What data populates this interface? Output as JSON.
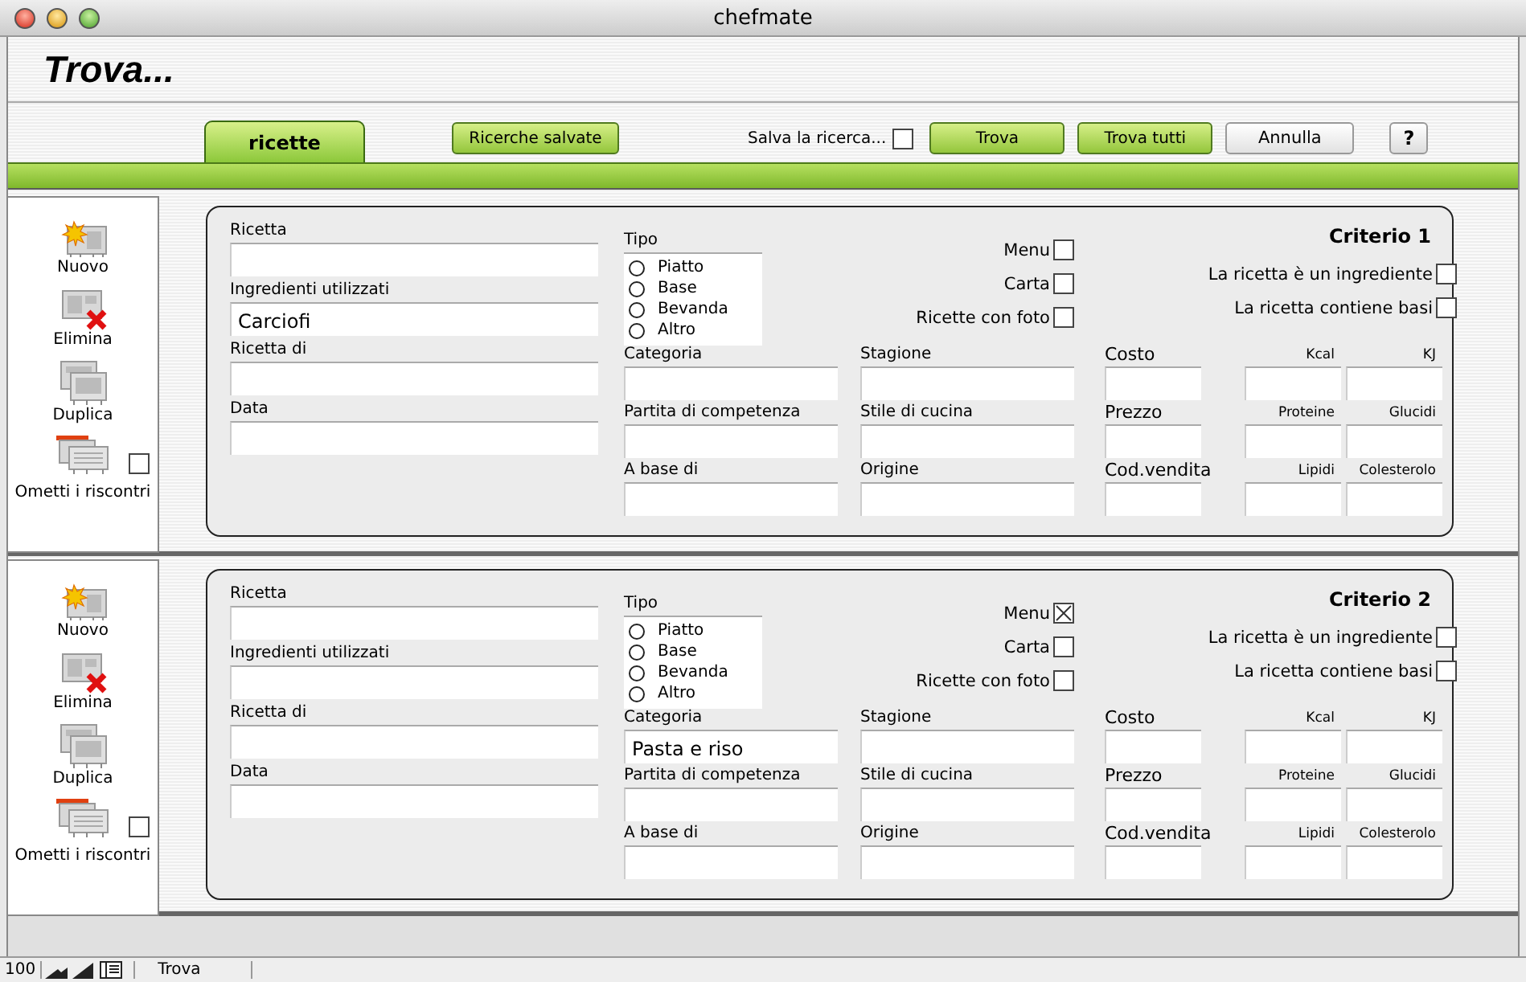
{
  "window": {
    "title": "chefmate"
  },
  "header": {
    "title": "Trova..."
  },
  "tabs": [
    {
      "label": "ricette",
      "selected": true
    }
  ],
  "toolbar": {
    "saved_searches": "Ricerche salvate",
    "save_search": {
      "label": "Salva la ricerca...",
      "checked": false
    },
    "buttons": [
      {
        "label": "Trova",
        "kind": "primary"
      },
      {
        "label": "Trova tutti",
        "kind": "primary"
      },
      {
        "label": "Annulla",
        "kind": "plain"
      },
      {
        "label": "?",
        "kind": "help"
      }
    ]
  },
  "requests": [
    {
      "sidebar": [
        {
          "kind": "new",
          "label": "Nuovo"
        },
        {
          "kind": "delete",
          "label": "Elimina"
        },
        {
          "kind": "duplicate",
          "label": "Duplica"
        },
        {
          "kind": "omit",
          "label": "Ometti i riscontri",
          "checked": false
        }
      ],
      "title": "Criterio 1",
      "column_a": [
        {
          "label": "Ricetta"
        },
        {
          "label": "Ingredienti utilizzati",
          "value": "Carciofi"
        },
        {
          "label": "Ricetta di"
        },
        {
          "label": "Data"
        }
      ],
      "tipo": {
        "label": "Tipo",
        "options": [
          {
            "label": "Piatto",
            "selected": false
          },
          {
            "label": "Base",
            "selected": false
          },
          {
            "label": "Bevanda",
            "selected": false
          },
          {
            "label": "Altro",
            "selected": false
          }
        ]
      },
      "column_b": [
        {
          "label": "Categoria"
        },
        {
          "label": "Partita di competenza"
        },
        {
          "label": "A base di"
        }
      ],
      "flags": [
        {
          "label": "Menu",
          "checked": false
        },
        {
          "label": "Carta",
          "checked": false
        },
        {
          "label": "Ricette con foto",
          "checked": false
        }
      ],
      "column_c": [
        {
          "label": "Stagione"
        },
        {
          "label": "Stile di cucina"
        },
        {
          "label": "Origine"
        }
      ],
      "column_d": [
        {
          "label": "Costo"
        },
        {
          "label": "Prezzo"
        },
        {
          "label": "Cod.vendita"
        }
      ],
      "options": [
        {
          "label": "La ricetta è un ingrediente",
          "checked": false
        },
        {
          "label": "La ricetta contiene basi",
          "checked": false
        }
      ],
      "nutrients": [
        {
          "label": "Kcal"
        },
        {
          "label": "KJ"
        },
        {
          "label": "Proteine"
        },
        {
          "label": "Glucidi"
        },
        {
          "label": "Lipidi"
        },
        {
          "label": "Colesterolo"
        }
      ]
    },
    {
      "sidebar": [
        {
          "kind": "new",
          "label": "Nuovo"
        },
        {
          "kind": "delete",
          "label": "Elimina"
        },
        {
          "kind": "duplicate",
          "label": "Duplica"
        },
        {
          "kind": "omit",
          "label": "Ometti i riscontri",
          "checked": false
        }
      ],
      "title": "Criterio 2",
      "column_a": [
        {
          "label": "Ricetta"
        },
        {
          "label": "Ingredienti utilizzati"
        },
        {
          "label": "Ricetta di"
        },
        {
          "label": "Data"
        }
      ],
      "tipo": {
        "label": "Tipo",
        "options": [
          {
            "label": "Piatto",
            "selected": false
          },
          {
            "label": "Base",
            "selected": false
          },
          {
            "label": "Bevanda",
            "selected": false
          },
          {
            "label": "Altro",
            "selected": false
          }
        ]
      },
      "column_b": [
        {
          "label": "Categoria",
          "value": "Pasta e riso"
        },
        {
          "label": "Partita di competenza"
        },
        {
          "label": "A base di"
        }
      ],
      "flags": [
        {
          "label": "Menu",
          "checked": true
        },
        {
          "label": "Carta",
          "checked": false
        },
        {
          "label": "Ricette con foto",
          "checked": false
        }
      ],
      "column_c": [
        {
          "label": "Stagione"
        },
        {
          "label": "Stile di cucina"
        },
        {
          "label": "Origine"
        }
      ],
      "column_d": [
        {
          "label": "Costo"
        },
        {
          "label": "Prezzo"
        },
        {
          "label": "Cod.vendita"
        }
      ],
      "options": [
        {
          "label": "La ricetta è un ingrediente",
          "checked": false
        },
        {
          "label": "La ricetta contiene basi",
          "checked": false
        }
      ],
      "nutrients": [
        {
          "label": "Kcal"
        },
        {
          "label": "KJ"
        },
        {
          "label": "Proteine"
        },
        {
          "label": "Glucidi"
        },
        {
          "label": "Lipidi"
        },
        {
          "label": "Colesterolo"
        }
      ]
    }
  ],
  "status_bar": {
    "zoom": "100",
    "mode": "Trova"
  }
}
